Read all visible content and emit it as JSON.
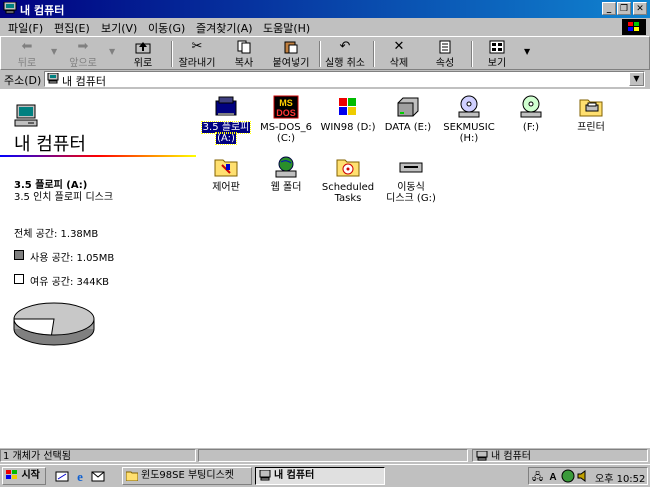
{
  "window": {
    "title": "내 컴퓨터"
  },
  "menu": [
    "파일(F)",
    "편집(E)",
    "보기(V)",
    "이동(G)",
    "즐겨찾기(A)",
    "도움말(H)"
  ],
  "toolbar": {
    "back": "뒤로",
    "forward": "앞으로",
    "up": "위로",
    "cut": "잘라내기",
    "copy": "복사",
    "paste": "붙여넣기",
    "undo": "실행 취소",
    "delete": "삭제",
    "properties": "속성",
    "view": "보기"
  },
  "address": {
    "label": "주소(D)",
    "value": "내 컴퓨터"
  },
  "leftpanel": {
    "title": "내 컴퓨터",
    "drive_name": "3.5 플로피 (A:)",
    "drive_desc": "3.5 인치 플로피 디스크",
    "total": "전체 공간: 1.38MB",
    "used": "사용 공간: 1.05MB",
    "free": "여유 공간: 344KB",
    "used_fraction": 0.76
  },
  "icons": [
    {
      "line1": "3.5 플로피",
      "line2": "(A:)"
    },
    {
      "line1": "MS-DOS_6",
      "line2": "(C:)"
    },
    {
      "line1": "WIN98 (D:)",
      "line2": ""
    },
    {
      "line1": "DATA (E:)",
      "line2": ""
    },
    {
      "line1": "SEKMUSIC",
      "line2": "(H:)"
    },
    {
      "line1": "(F:)",
      "line2": ""
    },
    {
      "line1": "프린터",
      "line2": ""
    },
    {
      "line1": "제어판",
      "line2": ""
    },
    {
      "line1": "웹 폴더",
      "line2": ""
    },
    {
      "line1": "Scheduled",
      "line2": "Tasks"
    },
    {
      "line1": "이동식",
      "line2": "디스크 (G:)"
    }
  ],
  "status": {
    "left": "1 개체가 선택됨",
    "right": "내 컴퓨터"
  },
  "taskbar": {
    "start": "시작",
    "task1": "윈도98SE 부팅디스켓",
    "task2": "내 컴퓨터",
    "clock": "오후 10:52"
  },
  "colors": {
    "titlebar": "#000080",
    "selection": "#000080",
    "desktop_gray": "#c0c0c0"
  }
}
